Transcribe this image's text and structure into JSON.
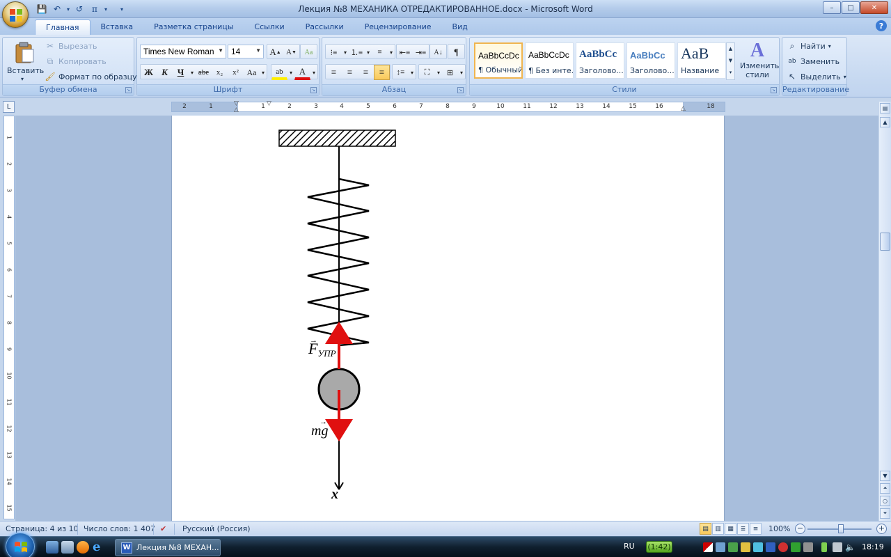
{
  "window": {
    "title": "Лекция №8 МЕХАНИКА ОТРЕДАКТИРОВАННОЕ.docx - Microsoft Word",
    "controls": {
      "minimize": "–",
      "maximize": "□",
      "close": "✕"
    }
  },
  "quick_access": {
    "save": "💾",
    "undo": "↶",
    "redo": "↺",
    "pi": "π"
  },
  "tabs": [
    "Главная",
    "Вставка",
    "Разметка страницы",
    "Ссылки",
    "Рассылки",
    "Рецензирование",
    "Вид"
  ],
  "ribbon": {
    "clipboard": {
      "label": "Буфер обмена",
      "paste": "Вставить",
      "cut": "Вырезать",
      "copy": "Копировать",
      "format_painter": "Формат по образцу"
    },
    "font": {
      "label": "Шрифт",
      "font_name": "Times New Roman",
      "font_size": "14",
      "bold": "Ж",
      "italic": "К",
      "underline": "Ч",
      "strike": "abe",
      "subscript": "x₂",
      "superscript": "x²",
      "change_case": "Aa"
    },
    "paragraph": {
      "label": "Абзац",
      "pilcrow": "¶"
    },
    "styles": {
      "label": "Стили",
      "items": [
        {
          "sample": "AaBbCcDc",
          "name": "¶ Обычный"
        },
        {
          "sample": "AaBbCcDc",
          "name": "¶ Без инте..."
        },
        {
          "sample": "AaBbCc",
          "name": "Заголово..."
        },
        {
          "sample": "AaBbCc",
          "name": "Заголово..."
        },
        {
          "sample": "AaB",
          "name": "Название"
        }
      ],
      "change_styles": "Изменить стили"
    },
    "editing": {
      "label": "Редактирование",
      "find": "Найти",
      "replace": "Заменить",
      "select": "Выделить"
    }
  },
  "ruler": {
    "marks": [
      "2",
      "1",
      "1",
      "2",
      "3",
      "4",
      "5",
      "6",
      "7",
      "8",
      "9",
      "10",
      "11",
      "12",
      "13",
      "14",
      "15",
      "16",
      "18"
    ],
    "vmarks": [
      "1",
      "2",
      "3",
      "4",
      "5",
      "6",
      "7",
      "8",
      "9",
      "10",
      "11",
      "12",
      "13",
      "14",
      "15"
    ]
  },
  "figure": {
    "force_label": "F",
    "force_sub": "УПР",
    "gravity_label": "mg",
    "axis_label": "x",
    "colors": {
      "arrow": "#e01010",
      "ball": "#a9a9a9",
      "line": "#000000"
    }
  },
  "status": {
    "page": "Страница: 4 из 10",
    "words": "Число слов: 1 407",
    "language": "Русский (Россия)",
    "zoom": "100%"
  },
  "taskbar": {
    "task": "Лекция №8 МЕХАН...",
    "lang": "RU",
    "badge": "(1:42)",
    "clock": "18:19"
  }
}
